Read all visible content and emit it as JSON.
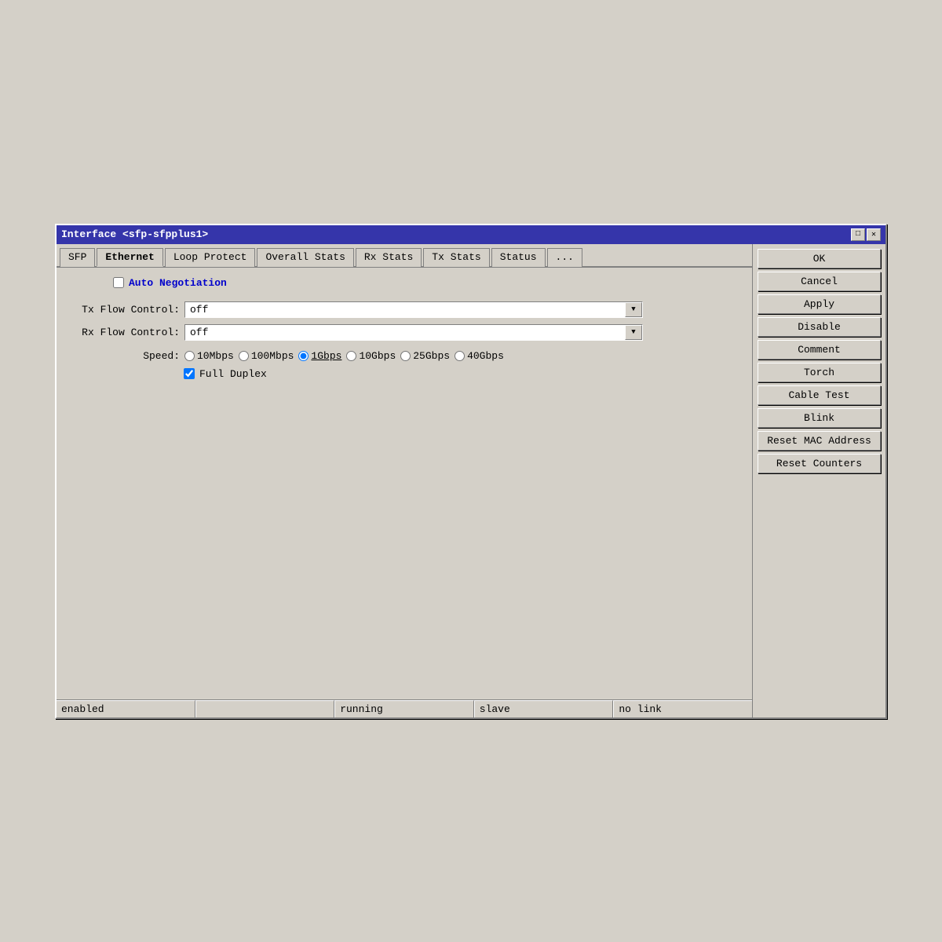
{
  "window": {
    "title": "Interface <sfp-sfpplus1>",
    "title_btn_minimize": "□",
    "title_btn_close": "✕"
  },
  "tabs": [
    {
      "label": "SFP",
      "active": false
    },
    {
      "label": "Ethernet",
      "active": true
    },
    {
      "label": "Loop Protect",
      "active": false
    },
    {
      "label": "Overall Stats",
      "active": false
    },
    {
      "label": "Rx Stats",
      "active": false
    },
    {
      "label": "Tx Stats",
      "active": false
    },
    {
      "label": "Status",
      "active": false
    },
    {
      "label": "...",
      "active": false
    }
  ],
  "auto_negotiation": {
    "label": "Auto Negotiation",
    "checked": false
  },
  "tx_flow_control": {
    "label": "Tx Flow Control:",
    "value": "off"
  },
  "rx_flow_control": {
    "label": "Rx Flow Control:",
    "value": "off"
  },
  "speed": {
    "label": "Speed:",
    "options": [
      {
        "label": "10Mbps",
        "value": "10mbps",
        "checked": false
      },
      {
        "label": "100Mbps",
        "value": "100mbps",
        "checked": false
      },
      {
        "label": "1Gbps",
        "value": "1gbps",
        "checked": true
      },
      {
        "label": "10Gbps",
        "value": "10gbps",
        "checked": false
      },
      {
        "label": "25Gbps",
        "value": "25gbps",
        "checked": false
      },
      {
        "label": "40Gbps",
        "value": "40gbps",
        "checked": false
      }
    ]
  },
  "full_duplex": {
    "label": "Full Duplex",
    "checked": true
  },
  "buttons": {
    "ok": "OK",
    "cancel": "Cancel",
    "apply": "Apply",
    "disable": "Disable",
    "comment": "Comment",
    "torch": "Torch",
    "cable_test": "Cable Test",
    "blink": "Blink",
    "reset_mac": "Reset MAC Address",
    "reset_counters": "Reset Counters"
  },
  "status_bar": {
    "enabled": "enabled",
    "running": "running",
    "slave": "slave",
    "no_link": "no link"
  },
  "arrow_symbol": "▼"
}
